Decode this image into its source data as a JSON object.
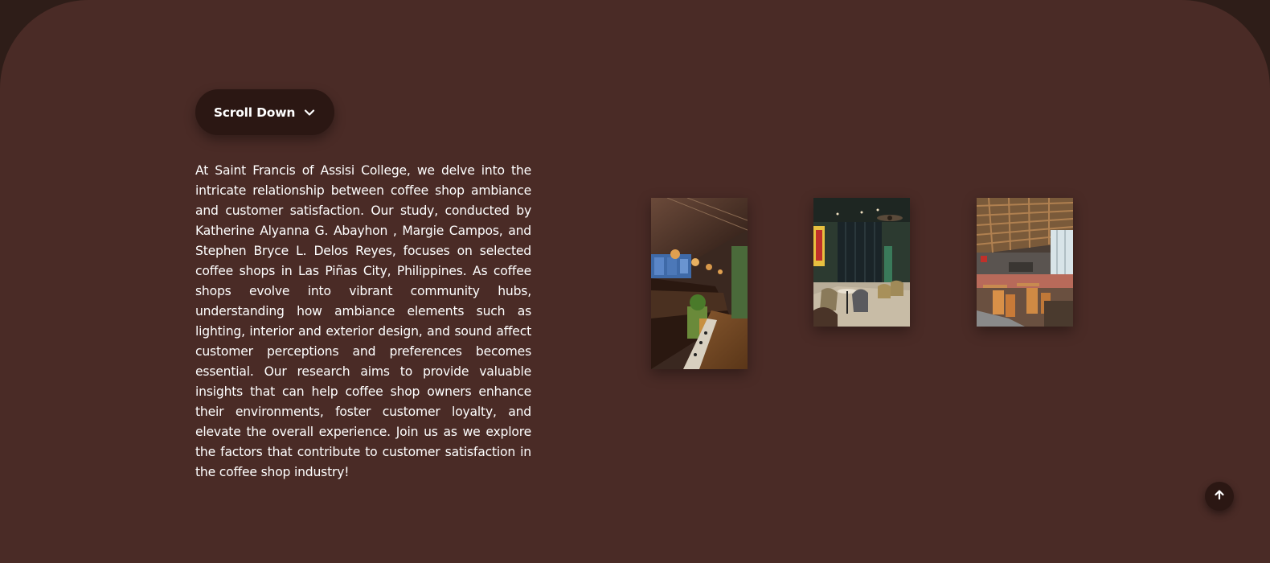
{
  "scroll_button": {
    "label": "Scroll Down",
    "icon": "chevron-down-icon"
  },
  "intro": {
    "text": "At Saint Francis of Assisi College, we delve into the intricate relationship between coffee shop ambiance and customer satisfaction. Our study, conducted by Katherine Alyanna G. Abayhon , Margie Campos, and Stephen Bryce L. Delos Reyes, focuses on selected coffee shops in Las Piñas City, Philippines. As coffee shops evolve into vibrant community hubs, understanding how ambiance elements such as lighting, interior and exterior design, and sound affect customer perceptions and preferences becomes essential. Our research aims to provide valuable insights that can help coffee shop owners enhance their environments, foster customer loyalty, and elevate the overall experience. Join us as we explore the factors that contribute to customer satisfaction in the coffee shop industry!"
  },
  "gallery": {
    "photos": [
      {
        "subject": "coffee shop counter with pendant lights"
      },
      {
        "subject": "coffee shop seating area with ceiling fan"
      },
      {
        "subject": "coffee shop interior with wooden slatted ceiling"
      }
    ]
  },
  "back_to_top": {
    "icon": "arrow-up-icon"
  },
  "colors": {
    "page_background": "#2e1d18",
    "panel_background": "#4a2b26",
    "button_background": "#2b1713",
    "text": "#ffffff"
  }
}
